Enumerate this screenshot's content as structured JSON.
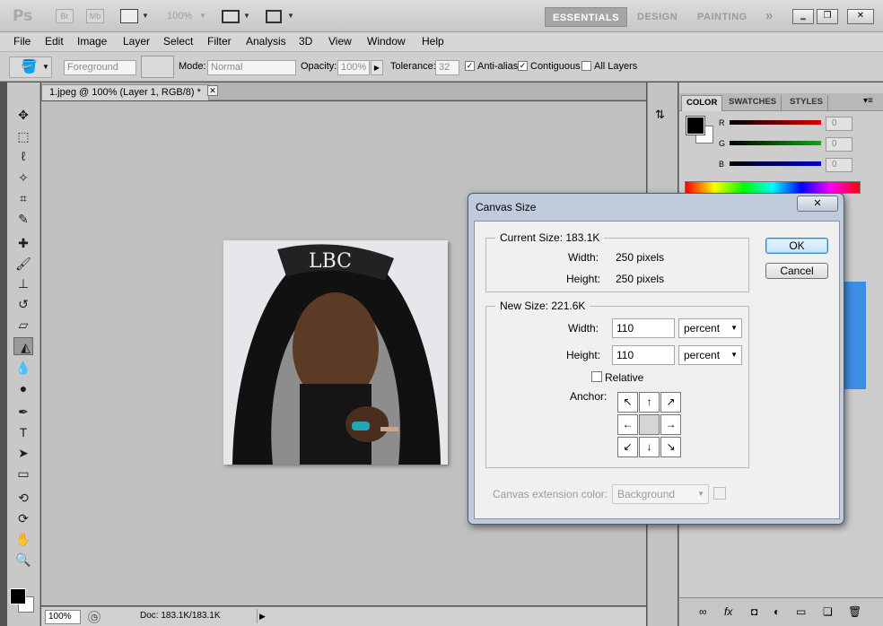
{
  "app": {
    "logo": "Ps",
    "bridge_label": "Br",
    "minibridge_label": "Mb",
    "zoom_level": "100%",
    "workspaces": [
      "ESSENTIALS",
      "DESIGN",
      "PAINTING"
    ],
    "more_workspaces": "»"
  },
  "menu": [
    "File",
    "Edit",
    "Image",
    "Layer",
    "Select",
    "Filter",
    "Analysis",
    "3D",
    "View",
    "Window",
    "Help"
  ],
  "options": {
    "fill_source": "Foreground",
    "mode_label": "Mode:",
    "mode_value": "Normal",
    "opacity_label": "Opacity:",
    "opacity_value": "100%",
    "tolerance_label": "Tolerance:",
    "tolerance_value": "32",
    "antialias_label": "Anti-alias",
    "contiguous_label": "Contiguous",
    "all_layers_label": "All Layers"
  },
  "document": {
    "tab_title": "1.jpeg @ 100% (Layer 1, RGB/8) *",
    "status_zoom": "100%",
    "status_doc": "Doc: 183.1K/183.1K"
  },
  "color_panel": {
    "tabs": [
      "COLOR",
      "SWATCHES",
      "STYLES"
    ],
    "channels": [
      {
        "label": "R",
        "value": "0",
        "color": "#d40000"
      },
      {
        "label": "G",
        "value": "0",
        "color": "#00b000"
      },
      {
        "label": "B",
        "value": "0",
        "color": "#0000c8"
      }
    ]
  },
  "dialog": {
    "title": "Canvas Size",
    "current_size_label": "Current Size: 183.1K",
    "current_width_label": "Width:",
    "current_width_value": "250 pixels",
    "current_height_label": "Height:",
    "current_height_value": "250 pixels",
    "new_size_label": "New Size: 221.6K",
    "new_width_label": "Width:",
    "new_width_value": "110",
    "new_width_unit": "percent",
    "new_height_label": "Height:",
    "new_height_value": "110",
    "new_height_unit": "percent",
    "relative_label": "Relative",
    "anchor_label": "Anchor:",
    "extension_color_label": "Canvas extension color:",
    "extension_color_value": "Background",
    "ok_label": "OK",
    "cancel_label": "Cancel"
  }
}
